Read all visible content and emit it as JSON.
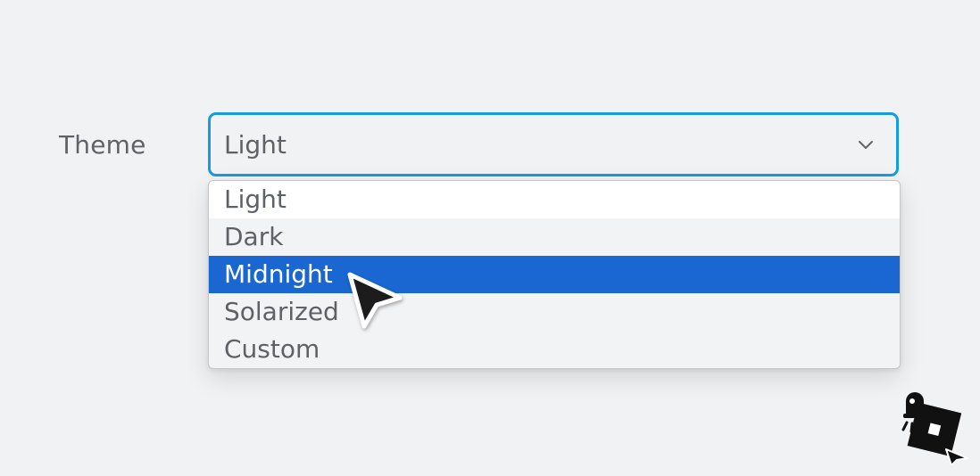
{
  "form": {
    "theme_label": "Theme"
  },
  "select": {
    "value": "Light",
    "icon": "chevron-down-icon",
    "focus_color": "#169bde",
    "options": [
      {
        "label": "Light"
      },
      {
        "label": "Dark"
      },
      {
        "label": "Midnight"
      },
      {
        "label": "Solarized"
      },
      {
        "label": "Custom"
      }
    ],
    "highlighted_option": "Midnight",
    "highlight_color": "#1a67d2"
  },
  "pointer": {
    "icon": "mouse-pointer-icon"
  },
  "watermark": {
    "icon": "robot-logo-icon"
  }
}
